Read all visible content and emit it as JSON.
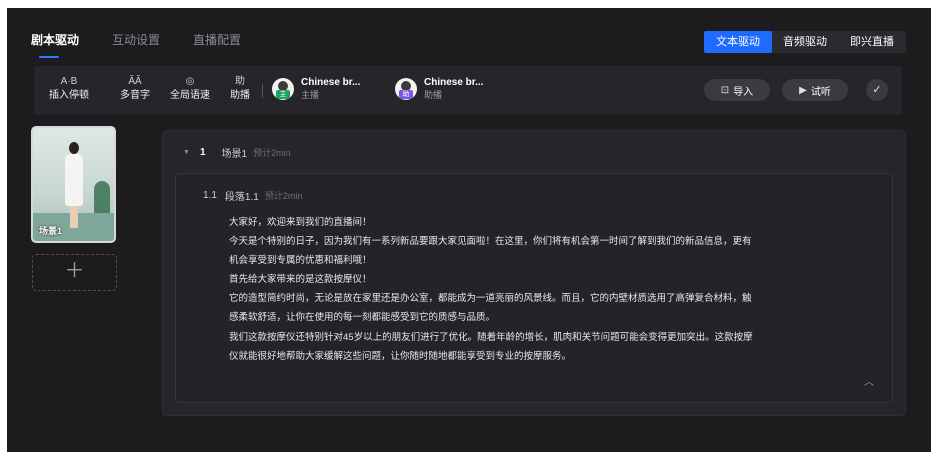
{
  "tabs": [
    {
      "label": "剧本驱动",
      "active": true
    },
    {
      "label": "互动设置",
      "active": false
    },
    {
      "label": "直播配置",
      "active": false
    }
  ],
  "modes": [
    {
      "label": "文本驱动",
      "active": true
    },
    {
      "label": "音频驱动",
      "active": false
    },
    {
      "label": "即兴直播",
      "active": false
    }
  ],
  "toolbar": {
    "tools": [
      {
        "icon": "A·B",
        "label": "插入停顿"
      },
      {
        "icon": "ĂĂ",
        "label": "多音字"
      },
      {
        "icon": "◎",
        "label": "全局语速"
      },
      {
        "icon": "助",
        "label": "助播"
      }
    ],
    "voices": [
      {
        "name": "Chinese br...",
        "role": "主播",
        "chip": "主"
      },
      {
        "name": "Chinese br...",
        "role": "助播",
        "chip": "助"
      }
    ],
    "import_label": "导入",
    "listen_label": "试听"
  },
  "scenes": [
    {
      "label": "场景1"
    }
  ],
  "script": {
    "scene": {
      "number": "1",
      "name": "场景1",
      "estimate": "预计2min"
    },
    "paragraph": {
      "number": "1.1",
      "name": "段落1.1",
      "estimate": "预计2min"
    },
    "lines": [
      "大家好，欢迎来到我们的直播间！",
      "今天是个特别的日子，因为我们有一系列新品要跟大家见面啦！在这里，你们将有机会第一时间了解到我们的新品信息，更有",
      "机会享受到专属的优惠和福利哦！",
      "首先给大家带来的是这款按摩仪！",
      "它的造型简约时尚，无论是放在家里还是办公室，都能成为一道亮丽的风景线。而且，它的内壁材质选用了高弹复合材料，触",
      "感柔软舒适，让你在使用的每一刻都能感受到它的质感与品质。",
      "我们这款按摩仪还特别针对45岁以上的朋友们进行了优化。随着年龄的增长，肌肉和关节问题可能会变得更加突出。这款按摩",
      "仪就能很好地帮助大家缓解这些问题，让你随时随地都能享受到专业的按摩服务。"
    ]
  },
  "colors": {
    "background": "#1c1c1f",
    "accent": "#1f6bff",
    "panel": "#26262a"
  }
}
